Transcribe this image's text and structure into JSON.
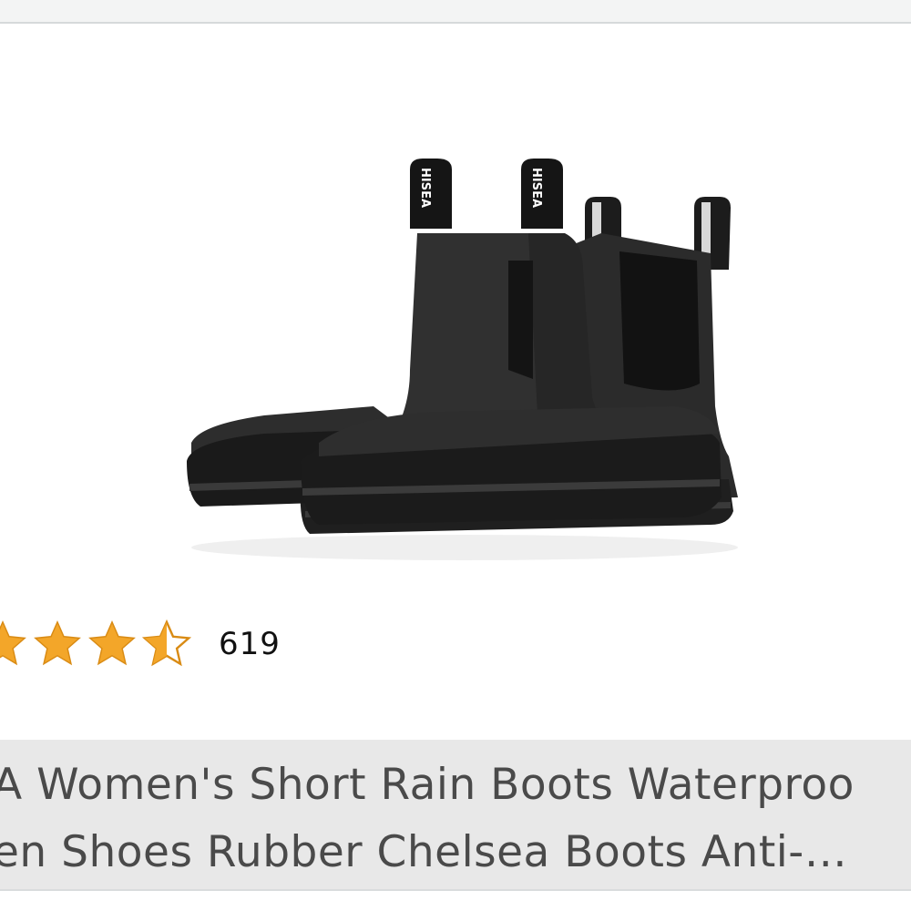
{
  "product": {
    "image_icon": "rain-boots-image",
    "tab_brand": "HISEA",
    "rating": {
      "value": 3.5,
      "max": 5,
      "count": "619",
      "star_color": "#f3a629"
    },
    "title_line1": "A Women's Short Rain Boots Waterproo",
    "title_line2": "en Shoes Rubber Chelsea Boots Anti-…"
  },
  "colors": {
    "title_background": "#e8e8e8",
    "title_text": "#4a4a4a",
    "boot": "#262727"
  }
}
